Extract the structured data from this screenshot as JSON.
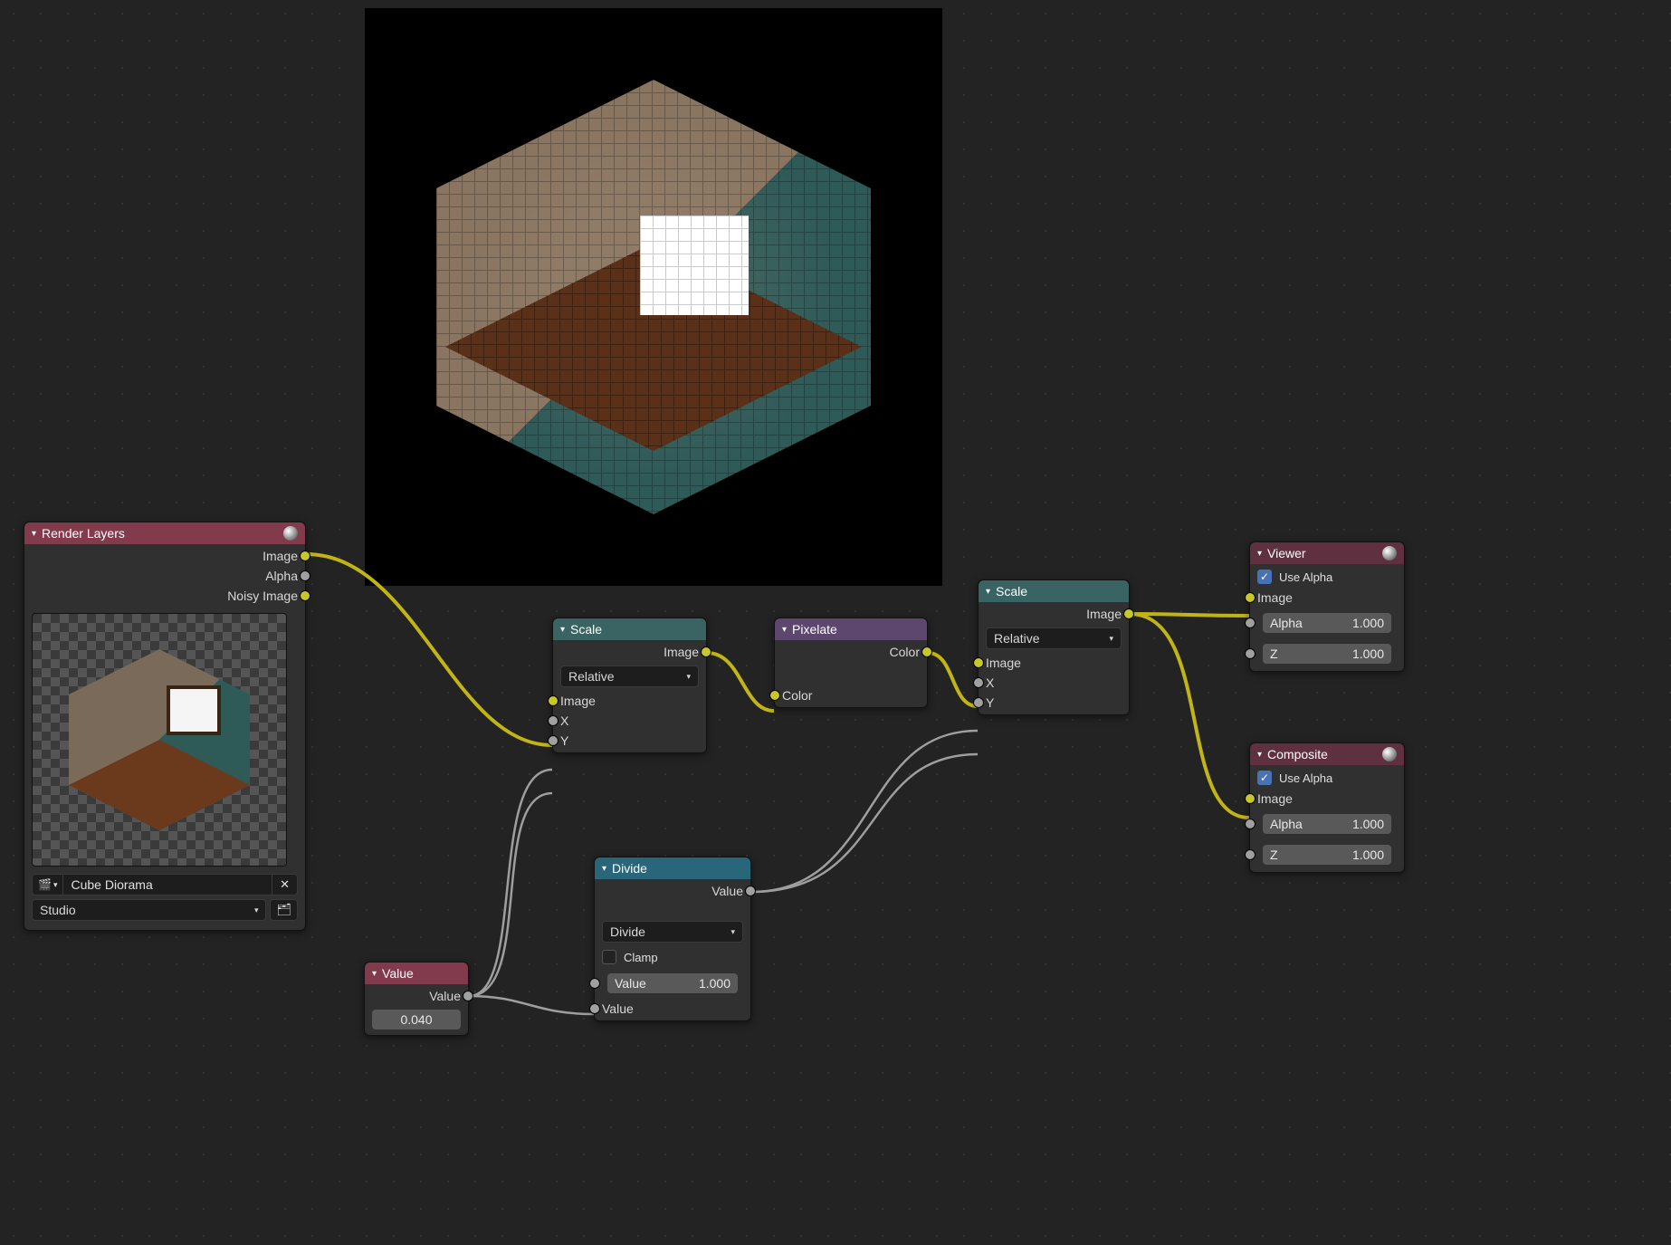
{
  "backdrop": {
    "visible": true
  },
  "nodes": {
    "render_layers": {
      "title": "Render Layers",
      "outputs": {
        "image": "Image",
        "alpha": "Alpha",
        "noisy": "Noisy Image"
      },
      "scene_name": "Cube Diorama",
      "view_layer": "Studio"
    },
    "scale1": {
      "title": "Scale",
      "outputs": {
        "image": "Image"
      },
      "method": "Relative",
      "inputs": {
        "image": "Image",
        "x": "X",
        "y": "Y"
      }
    },
    "pixelate": {
      "title": "Pixelate",
      "outputs": {
        "color": "Color"
      },
      "inputs": {
        "color": "Color"
      }
    },
    "scale2": {
      "title": "Scale",
      "outputs": {
        "image": "Image"
      },
      "method": "Relative",
      "inputs": {
        "image": "Image",
        "x": "X",
        "y": "Y"
      }
    },
    "value": {
      "title": "Value",
      "outputs": {
        "value": "Value"
      },
      "value": "0.040"
    },
    "divide": {
      "title": "Divide",
      "outputs": {
        "value": "Value"
      },
      "operation": "Divide",
      "clamp_label": "Clamp",
      "clamp": false,
      "input_value_label": "Value",
      "input_value": "1.000",
      "inputs": {
        "value2": "Value"
      }
    },
    "viewer": {
      "title": "Viewer",
      "use_alpha_label": "Use Alpha",
      "use_alpha": true,
      "inputs": {
        "image": "Image"
      },
      "alpha_label": "Alpha",
      "alpha_value": "1.000",
      "z_label": "Z",
      "z_value": "1.000"
    },
    "composite": {
      "title": "Composite",
      "use_alpha_label": "Use Alpha",
      "use_alpha": true,
      "inputs": {
        "image": "Image"
      },
      "alpha_label": "Alpha",
      "alpha_value": "1.000",
      "z_label": "Z",
      "z_value": "1.000"
    }
  }
}
